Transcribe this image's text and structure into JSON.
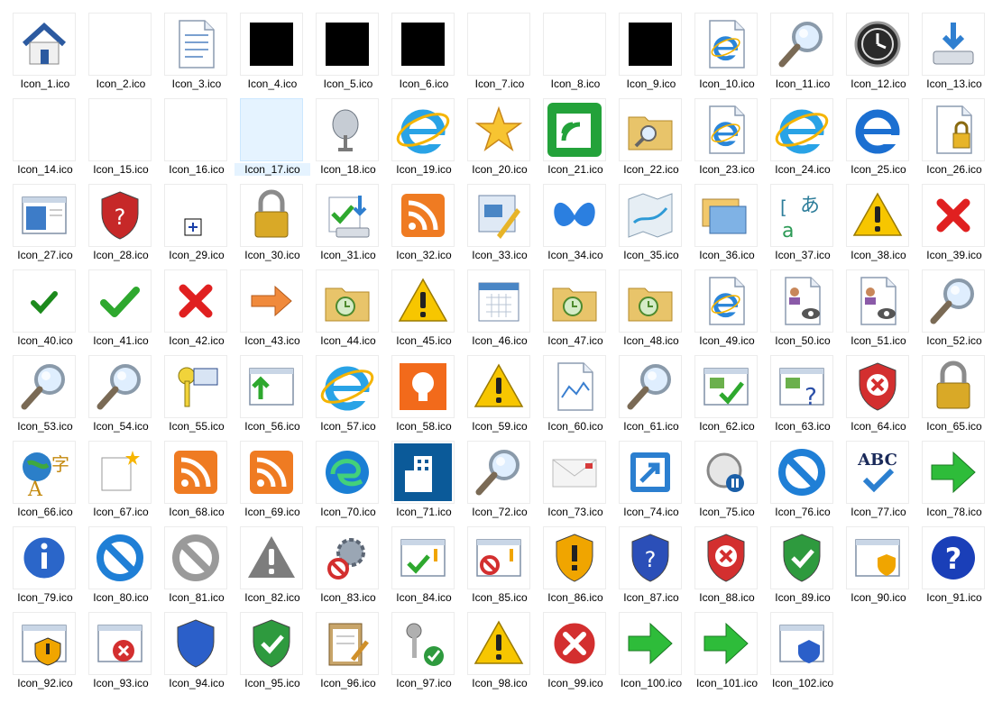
{
  "window": {
    "background": "#ffffff"
  },
  "grid": {
    "selected_index": 16,
    "items": [
      {
        "label": "Icon_1.ico",
        "icon": "house-icon"
      },
      {
        "label": "Icon_2.ico",
        "icon": "blank-icon"
      },
      {
        "label": "Icon_3.ico",
        "icon": "document-icon"
      },
      {
        "label": "Icon_4.ico",
        "icon": "black-square-icon"
      },
      {
        "label": "Icon_5.ico",
        "icon": "black-square-icon"
      },
      {
        "label": "Icon_6.ico",
        "icon": "black-square-icon"
      },
      {
        "label": "Icon_7.ico",
        "icon": "blank-icon"
      },
      {
        "label": "Icon_8.ico",
        "icon": "blank-icon"
      },
      {
        "label": "Icon_9.ico",
        "icon": "black-square-icon"
      },
      {
        "label": "Icon_10.ico",
        "icon": "ie-document-icon"
      },
      {
        "label": "Icon_11.ico",
        "icon": "magnifier-icon"
      },
      {
        "label": "Icon_12.ico",
        "icon": "clock-icon"
      },
      {
        "label": "Icon_13.ico",
        "icon": "drive-download-icon"
      },
      {
        "label": "Icon_14.ico",
        "icon": "blank-icon"
      },
      {
        "label": "Icon_15.ico",
        "icon": "blank-icon"
      },
      {
        "label": "Icon_16.ico",
        "icon": "blank-icon"
      },
      {
        "label": "Icon_17.ico",
        "icon": "blank-icon"
      },
      {
        "label": "Icon_18.ico",
        "icon": "satellite-dish-icon"
      },
      {
        "label": "Icon_19.ico",
        "icon": "ie-logo-icon"
      },
      {
        "label": "Icon_20.ico",
        "icon": "star-icon"
      },
      {
        "label": "Icon_21.ico",
        "icon": "green-feed-icon"
      },
      {
        "label": "Icon_22.ico",
        "icon": "folder-search-icon"
      },
      {
        "label": "Icon_23.ico",
        "icon": "ie-document-icon"
      },
      {
        "label": "Icon_24.ico",
        "icon": "ie-logo-icon"
      },
      {
        "label": "Icon_25.ico",
        "icon": "ie-blue-logo-icon"
      },
      {
        "label": "Icon_26.ico",
        "icon": "document-lock-icon"
      },
      {
        "label": "Icon_27.ico",
        "icon": "window-panel-icon"
      },
      {
        "label": "Icon_28.ico",
        "icon": "red-shield-question-icon"
      },
      {
        "label": "Icon_29.ico",
        "icon": "small-plus-box-icon"
      },
      {
        "label": "Icon_30.ico",
        "icon": "padlock-icon"
      },
      {
        "label": "Icon_31.ico",
        "icon": "drive-check-download-icon"
      },
      {
        "label": "Icon_32.ico",
        "icon": "rss-icon"
      },
      {
        "label": "Icon_33.ico",
        "icon": "picture-edit-icon"
      },
      {
        "label": "Icon_34.ico",
        "icon": "blue-butterfly-icon"
      },
      {
        "label": "Icon_35.ico",
        "icon": "map-icon"
      },
      {
        "label": "Icon_36.ico",
        "icon": "windows-stack-icon"
      },
      {
        "label": "Icon_37.ico",
        "icon": "translate-icon"
      },
      {
        "label": "Icon_38.ico",
        "icon": "warning-icon"
      },
      {
        "label": "Icon_39.ico",
        "icon": "red-x-icon"
      },
      {
        "label": "Icon_40.ico",
        "icon": "small-check-icon"
      },
      {
        "label": "Icon_41.ico",
        "icon": "check-icon"
      },
      {
        "label": "Icon_42.ico",
        "icon": "red-x-icon"
      },
      {
        "label": "Icon_43.ico",
        "icon": "orange-arrow-icon"
      },
      {
        "label": "Icon_44.ico",
        "icon": "folder-history-icon"
      },
      {
        "label": "Icon_45.ico",
        "icon": "warning-icon"
      },
      {
        "label": "Icon_46.ico",
        "icon": "calendar-icon"
      },
      {
        "label": "Icon_47.ico",
        "icon": "folder-history-icon"
      },
      {
        "label": "Icon_48.ico",
        "icon": "folder-history-icon"
      },
      {
        "label": "Icon_49.ico",
        "icon": "ie-document-icon"
      },
      {
        "label": "Icon_50.ico",
        "icon": "profile-view-icon"
      },
      {
        "label": "Icon_51.ico",
        "icon": "profile-view-icon"
      },
      {
        "label": "Icon_52.ico",
        "icon": "magnifier-icon"
      },
      {
        "label": "Icon_53.ico",
        "icon": "magnifier-icon"
      },
      {
        "label": "Icon_54.ico",
        "icon": "magnifier-icon"
      },
      {
        "label": "Icon_55.ico",
        "icon": "key-id-icon"
      },
      {
        "label": "Icon_56.ico",
        "icon": "window-up-arrow-icon"
      },
      {
        "label": "Icon_57.ico",
        "icon": "ie-logo-icon"
      },
      {
        "label": "Icon_58.ico",
        "icon": "lightbulb-icon"
      },
      {
        "label": "Icon_59.ico",
        "icon": "warning-icon"
      },
      {
        "label": "Icon_60.ico",
        "icon": "broken-image-icon"
      },
      {
        "label": "Icon_61.ico",
        "icon": "magnifier-icon"
      },
      {
        "label": "Icon_62.ico",
        "icon": "image-check-icon"
      },
      {
        "label": "Icon_63.ico",
        "icon": "image-question-icon"
      },
      {
        "label": "Icon_64.ico",
        "icon": "red-shield-x-icon"
      },
      {
        "label": "Icon_65.ico",
        "icon": "padlock-icon"
      },
      {
        "label": "Icon_66.ico",
        "icon": "globe-language-icon"
      },
      {
        "label": "Icon_67.ico",
        "icon": "new-item-icon"
      },
      {
        "label": "Icon_68.ico",
        "icon": "rss-icon"
      },
      {
        "label": "Icon_69.ico",
        "icon": "rss-icon"
      },
      {
        "label": "Icon_70.ico",
        "icon": "edge-logo-icon"
      },
      {
        "label": "Icon_71.ico",
        "icon": "office-building-icon"
      },
      {
        "label": "Icon_72.ico",
        "icon": "magnifier-icon"
      },
      {
        "label": "Icon_73.ico",
        "icon": "envelope-icon"
      },
      {
        "label": "Icon_74.ico",
        "icon": "shortcut-arrow-icon"
      },
      {
        "label": "Icon_75.ico",
        "icon": "history-pause-icon"
      },
      {
        "label": "Icon_76.ico",
        "icon": "blocked-icon"
      },
      {
        "label": "Icon_77.ico",
        "icon": "spellcheck-icon"
      },
      {
        "label": "Icon_78.ico",
        "icon": "green-arrow-icon"
      },
      {
        "label": "Icon_79.ico",
        "icon": "info-icon"
      },
      {
        "label": "Icon_80.ico",
        "icon": "blocked-icon"
      },
      {
        "label": "Icon_81.ico",
        "icon": "gray-blocked-icon"
      },
      {
        "label": "Icon_82.ico",
        "icon": "gray-warning-icon"
      },
      {
        "label": "Icon_83.ico",
        "icon": "gear-blocked-icon"
      },
      {
        "label": "Icon_84.ico",
        "icon": "window-check-icon"
      },
      {
        "label": "Icon_85.ico",
        "icon": "window-blocked-icon"
      },
      {
        "label": "Icon_86.ico",
        "icon": "shield-warning-icon"
      },
      {
        "label": "Icon_87.ico",
        "icon": "shield-question-icon"
      },
      {
        "label": "Icon_88.ico",
        "icon": "red-shield-x-icon"
      },
      {
        "label": "Icon_89.ico",
        "icon": "green-shield-check-icon"
      },
      {
        "label": "Icon_90.ico",
        "icon": "window-shield-icon"
      },
      {
        "label": "Icon_91.ico",
        "icon": "help-icon"
      },
      {
        "label": "Icon_92.ico",
        "icon": "window-shield-warning-icon"
      },
      {
        "label": "Icon_93.ico",
        "icon": "window-error-icon"
      },
      {
        "label": "Icon_94.ico",
        "icon": "blue-shield-icon"
      },
      {
        "label": "Icon_95.ico",
        "icon": "green-shield-check-icon"
      },
      {
        "label": "Icon_96.ico",
        "icon": "clipboard-edit-icon"
      },
      {
        "label": "Icon_97.ico",
        "icon": "keys-check-icon"
      },
      {
        "label": "Icon_98.ico",
        "icon": "warning-icon"
      },
      {
        "label": "Icon_99.ico",
        "icon": "error-icon"
      },
      {
        "label": "Icon_100.ico",
        "icon": "green-arrow-icon"
      },
      {
        "label": "Icon_101.ico",
        "icon": "green-arrow-icon"
      },
      {
        "label": "Icon_102.ico",
        "icon": "window-blue-shield-icon"
      }
    ]
  }
}
